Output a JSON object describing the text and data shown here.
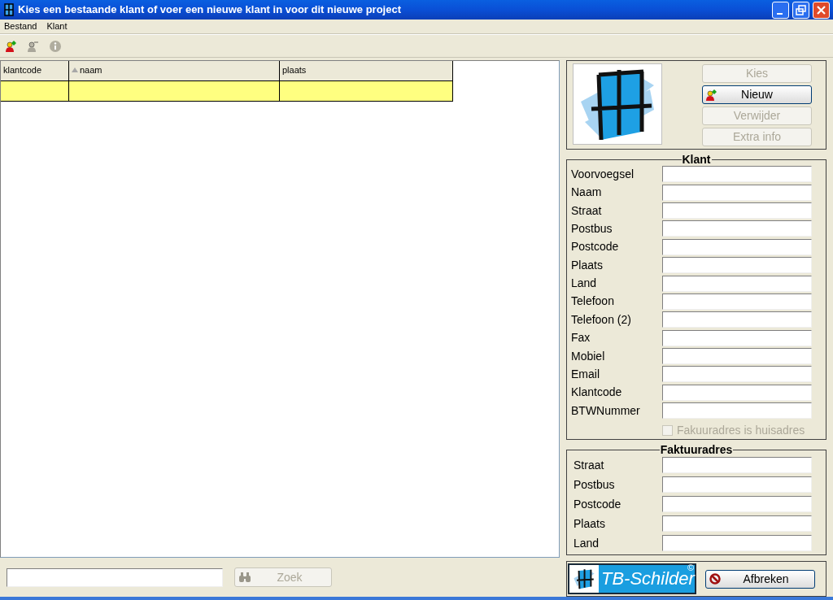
{
  "window": {
    "title": "Kies een bestaande klant of voer een nieuwe klant in voor dit nieuwe project"
  },
  "menu": [
    {
      "label": "Bestand"
    },
    {
      "label": "Klant"
    }
  ],
  "toolbar": [
    {
      "kind": "add-person",
      "disabled": false
    },
    {
      "kind": "remove-person",
      "disabled": true
    },
    {
      "kind": "info",
      "disabled": true
    }
  ],
  "grid": {
    "columns": [
      {
        "label": "klantcode",
        "sorted": false
      },
      {
        "label": "naam",
        "sorted": true
      },
      {
        "label": "plaats",
        "sorted": false
      }
    ],
    "rows": [
      {
        "selected": true
      }
    ]
  },
  "search": {
    "button": {
      "label": "Zoek",
      "disabled": true
    }
  },
  "actions": [
    {
      "label": "Kies",
      "disabled": true,
      "icon": false
    },
    {
      "label": "Nieuw",
      "disabled": false,
      "icon": true
    },
    {
      "label": "Verwijder",
      "disabled": true,
      "icon": false
    },
    {
      "label": "Extra info",
      "disabled": true,
      "icon": false
    }
  ],
  "klant": {
    "title": "Klant",
    "fields": [
      {
        "label": "Voorvoegsel"
      },
      {
        "label": "Naam"
      },
      {
        "label": "Straat"
      },
      {
        "label": "Postbus"
      },
      {
        "label": "Postcode"
      },
      {
        "label": "Plaats"
      },
      {
        "label": "Land"
      },
      {
        "label": "Telefoon"
      },
      {
        "label": "Telefoon (2)"
      },
      {
        "label": "Fax"
      },
      {
        "label": "Mobiel"
      },
      {
        "label": "Email"
      },
      {
        "label": "Klantcode"
      },
      {
        "label": "BTWNummer"
      }
    ],
    "checkbox": {
      "label": "Fakuuradres is huisadres",
      "checked": false,
      "disabled": true
    }
  },
  "faktuuradres": {
    "title": "Faktuuradres",
    "fields": [
      {
        "label": "Straat"
      },
      {
        "label": "Postbus"
      },
      {
        "label": "Postcode"
      },
      {
        "label": "Plaats"
      },
      {
        "label": "Land"
      }
    ]
  },
  "footer": {
    "logo": {
      "text": "TB-Schilder",
      "mark": "©"
    },
    "button": {
      "label": "Afbreken",
      "disabled": false
    }
  }
}
